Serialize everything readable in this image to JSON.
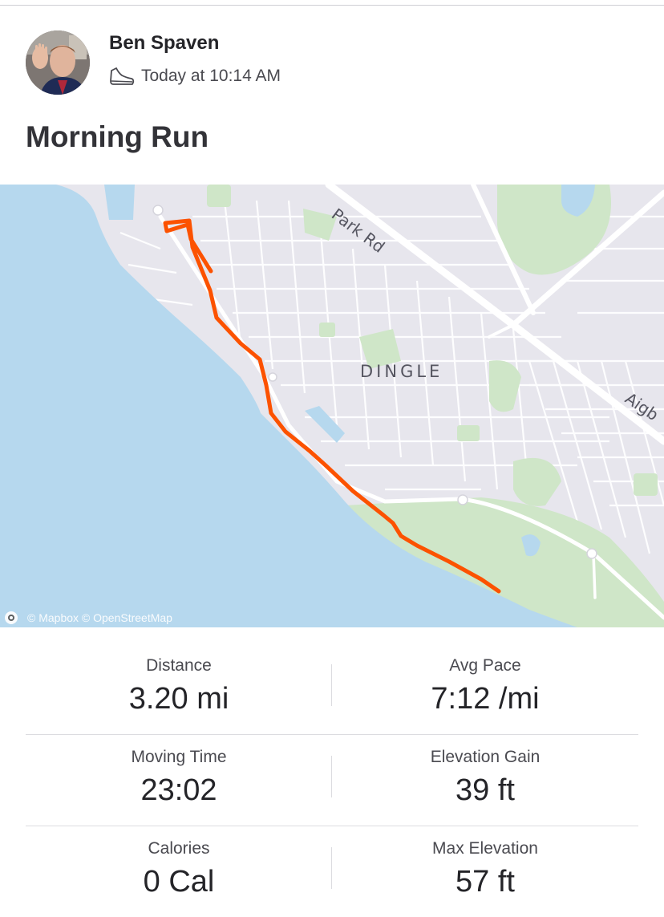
{
  "athlete": {
    "name": "Ben Spaven",
    "timestamp": "Today at 10:14 AM",
    "activity_icon": "shoe-icon"
  },
  "activity": {
    "title": "Morning Run"
  },
  "map": {
    "labels": {
      "park_rd": "Park Rd",
      "dingle": "DINGLE",
      "aigb": "Aigb"
    },
    "attribution": "© Mapbox © OpenStreetMap",
    "route_color": "#fc5200",
    "water_color": "#b6d8ee",
    "park_color": "#cfe6c8"
  },
  "stats": [
    {
      "label": "Distance",
      "value": "3.20 mi"
    },
    {
      "label": "Avg Pace",
      "value": "7:12 /mi"
    },
    {
      "label": "Moving Time",
      "value": "23:02"
    },
    {
      "label": "Elevation Gain",
      "value": "39 ft"
    },
    {
      "label": "Calories",
      "value": "0 Cal"
    },
    {
      "label": "Max Elevation",
      "value": "57 ft"
    }
  ]
}
